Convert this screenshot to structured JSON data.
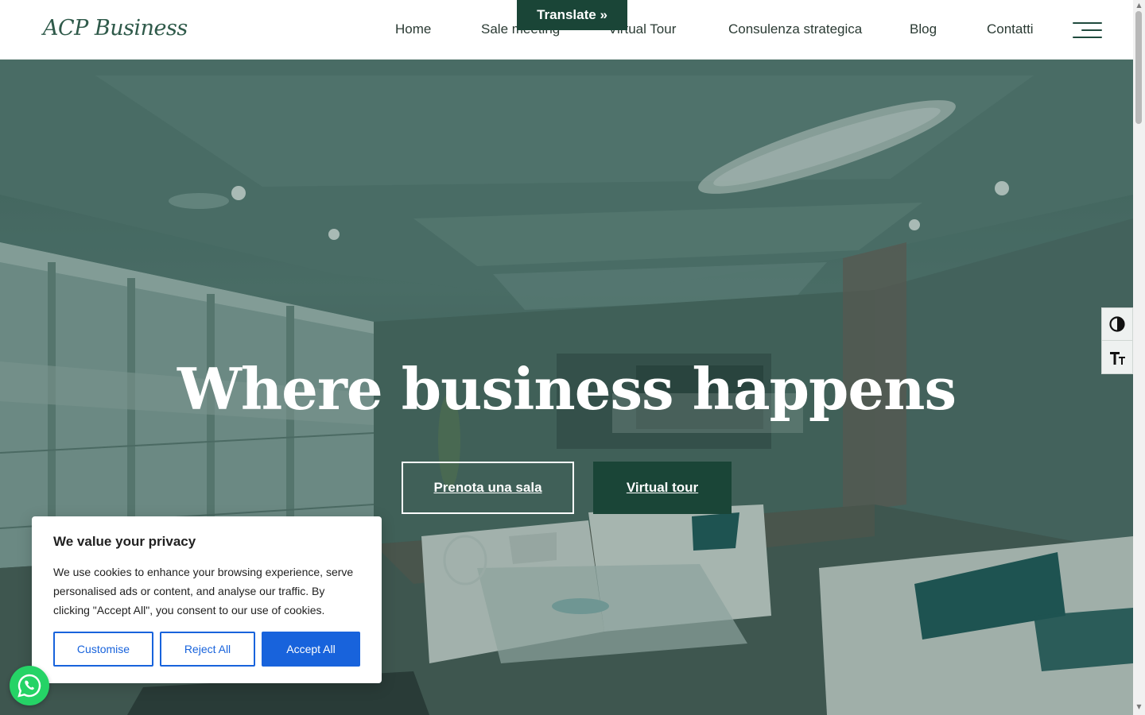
{
  "header": {
    "logo": "ACP Business",
    "nav": [
      {
        "label": "Home"
      },
      {
        "label": "Sale meeting"
      },
      {
        "label": "Virtual Tour"
      },
      {
        "label": "Consulenza strategica"
      },
      {
        "label": "Blog"
      },
      {
        "label": "Contatti"
      }
    ],
    "menu_icon": "hamburger-menu-icon"
  },
  "translate": {
    "label": "Translate »"
  },
  "hero": {
    "title": "Where business happens",
    "primary_cta": "Prenota una sala",
    "secondary_cta": "Virtual tour"
  },
  "accessibility": {
    "contrast_icon": "contrast-icon",
    "font_size_icon": "font-size-icon"
  },
  "cookie_banner": {
    "title": "We value your privacy",
    "text": "We use cookies to enhance your browsing experience, serve personalised ads or content, and analyse our traffic. By clicking \"Accept All\", you consent to our use of cookies.",
    "customise_label": "Customise",
    "reject_label": "Reject All",
    "accept_label": "Accept All"
  },
  "whatsapp": {
    "icon": "whatsapp-icon"
  },
  "colors": {
    "brand_green": "#1a4537",
    "cookie_accent": "#1863dc",
    "whatsapp_green": "#25d366"
  }
}
